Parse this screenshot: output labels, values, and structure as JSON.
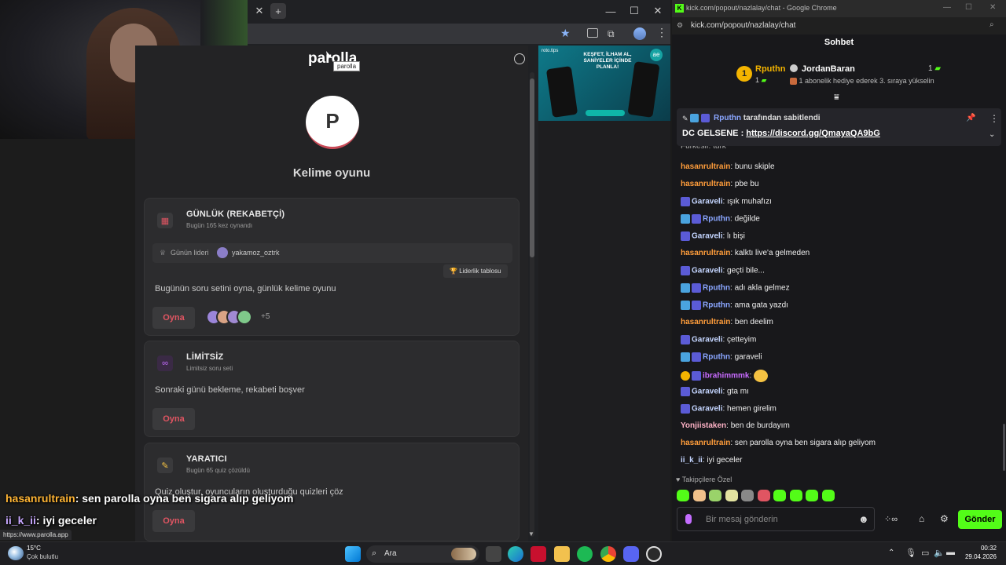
{
  "left_browser": {
    "tooltip": "parolla",
    "status_url": "https://www.parolla.app",
    "ad_header": "KEŞFET, İLHAM AL, SANİYELER İÇİNDE PLANLA!",
    "ad_brand": "roto.tips"
  },
  "parolla": {
    "logo": "parolla",
    "avatar_letter": "P",
    "title": "Kelime oyunu",
    "cards": [
      {
        "title": "GÜNLÜK (REKABETÇİ)",
        "subtitle": "Bugün 165 kez oynandı",
        "leader_label": "Günün lideri",
        "leader_name": "yakamoz_oztrk",
        "leaderboard_label": "Liderlik tablosu",
        "description": "Bugünün soru setini oyna, günlük kelime oyunu",
        "play_label": "Oyna",
        "extra_count": "+5"
      },
      {
        "title": "LİMİTSİZ",
        "subtitle": "Limitsiz soru seti",
        "description": "Sonraki günü bekleme, rekabeti boşver",
        "play_label": "Oyna"
      },
      {
        "title": "YARATICI",
        "subtitle": "Bugün 65 quiz çözüldü",
        "description": "Quiz oluştur, oyuncuların oluşturduğu quizleri çöz",
        "play_label": "Oyna"
      }
    ]
  },
  "chat_window": {
    "window_title": "kick.com/popout/nazlalay/chat - Google Chrome",
    "address": "kick.com/popout/nazlalay/chat",
    "header": "Sohbet",
    "leader": {
      "rank": "1",
      "name": "Rputhn",
      "count": "1"
    },
    "gifter": {
      "name": "JordanBaran",
      "count": "1",
      "text": "1 abonelik hediye ederek 3. sıraya yükselin"
    },
    "pinned": {
      "by_user": "Rputhn",
      "by_text": "tarafından sabitlendi",
      "prefix": "DC GELSENE :",
      "link": "https://discord.gg/QmayaQA9bG"
    },
    "partial_line": "Furkesif: turk",
    "messages": [
      {
        "user": "hasanrultrain",
        "text": "bunu skiple",
        "color": "#ff9d3b"
      },
      {
        "user": "hasanrultrain",
        "text": "pbe bu",
        "color": "#ff9d3b"
      },
      {
        "user": "Garaveli",
        "text": "ışık muhafızı",
        "color": "#c4d5ff"
      },
      {
        "user": "Rputhn",
        "text": "değilde",
        "color": "#8aa6ff"
      },
      {
        "user": "Garaveli",
        "text": "lı bişi",
        "color": "#c4d5ff"
      },
      {
        "user": "hasanrultrain",
        "text": "kalktı live'a gelmeden",
        "color": "#ff9d3b"
      },
      {
        "user": "Garaveli",
        "text": "geçti bile...",
        "color": "#c4d5ff"
      },
      {
        "user": "Rputhn",
        "text": "adı akla gelmez",
        "color": "#8aa6ff"
      },
      {
        "user": "Rputhn",
        "text": "ama gata yazdı",
        "color": "#8aa6ff"
      },
      {
        "user": "hasanrultrain",
        "text": "ben deelim",
        "color": "#ff9d3b"
      },
      {
        "user": "Garaveli",
        "text": "çetteyim",
        "color": "#c4d5ff"
      },
      {
        "user": "Rputhn",
        "text": "garaveli",
        "color": "#8aa6ff"
      },
      {
        "user": "ibrahimmmk",
        "text": "",
        "color": "#c86bff"
      },
      {
        "user": "Garaveli",
        "text": "gta mı",
        "color": "#c4d5ff"
      },
      {
        "user": "Garaveli",
        "text": "hemen girelim",
        "color": "#c4d5ff"
      },
      {
        "user": "Yonjiistaken",
        "text": "ben de burdayım",
        "color": "#ffb3c7"
      },
      {
        "user": "hasanrultrain",
        "text": "sen parolla oyna ben sigara alıp geliyom",
        "color": "#ff9d3b"
      },
      {
        "user": "ii_k_ii",
        "text": "iyi geceler",
        "color": "#c4d5ff"
      }
    ],
    "followers_only_label": "Takipçilere Özel",
    "input_placeholder": "Bir mesaj gönderin",
    "send_label": "Gönder"
  },
  "overlay": {
    "line1_user": "hasanrultrain",
    "line1_text": ": sen parolla oyna ben sigara alıp geliyom",
    "line2_user": "ii_k_ii",
    "line2_text": ": iyi geceler"
  },
  "taskbar": {
    "weather_temp": "15°C",
    "weather_desc": "Çok bulutlu",
    "search_label": "Ara",
    "time": "00:32",
    "date": "29.04.2026"
  }
}
